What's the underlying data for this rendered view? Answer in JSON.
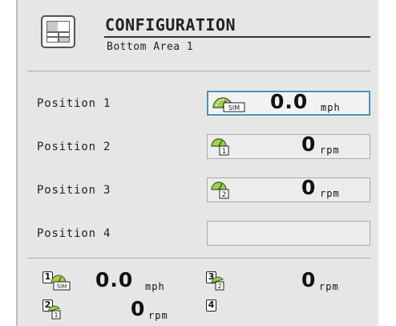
{
  "header": {
    "title": "CONFIGURATION",
    "subtitle": "Bottom Area 1"
  },
  "positions": [
    {
      "label": "Position 1",
      "value": "0.0",
      "unit": "mph",
      "icon": "sim-speed-gauge-icon",
      "selected": true
    },
    {
      "label": "Position 2",
      "value": "0",
      "unit": "rpm",
      "icon": "shaft-speed-1-icon",
      "selected": false
    },
    {
      "label": "Position 3",
      "value": "0",
      "unit": "rpm",
      "icon": "shaft-speed-2-icon",
      "selected": false
    },
    {
      "label": "Position 4",
      "value": "",
      "unit": "",
      "icon": "",
      "selected": false
    }
  ],
  "preview": [
    {
      "badge": "1",
      "value": "0.0",
      "unit": "mph",
      "icon": "sim-speed-gauge-icon"
    },
    {
      "badge": "3",
      "value": "0",
      "unit": "rpm",
      "icon": "shaft-speed-2-icon"
    },
    {
      "badge": "2",
      "value": "0",
      "unit": "rpm",
      "icon": "shaft-speed-1-icon"
    },
    {
      "badge": "4",
      "value": "",
      "unit": "",
      "icon": ""
    }
  ],
  "colors": {
    "background": "#e6e6e6",
    "selected_border": "#4a8fb8",
    "gauge_green": "#7fb23e",
    "sim_red": "#cc2222"
  }
}
